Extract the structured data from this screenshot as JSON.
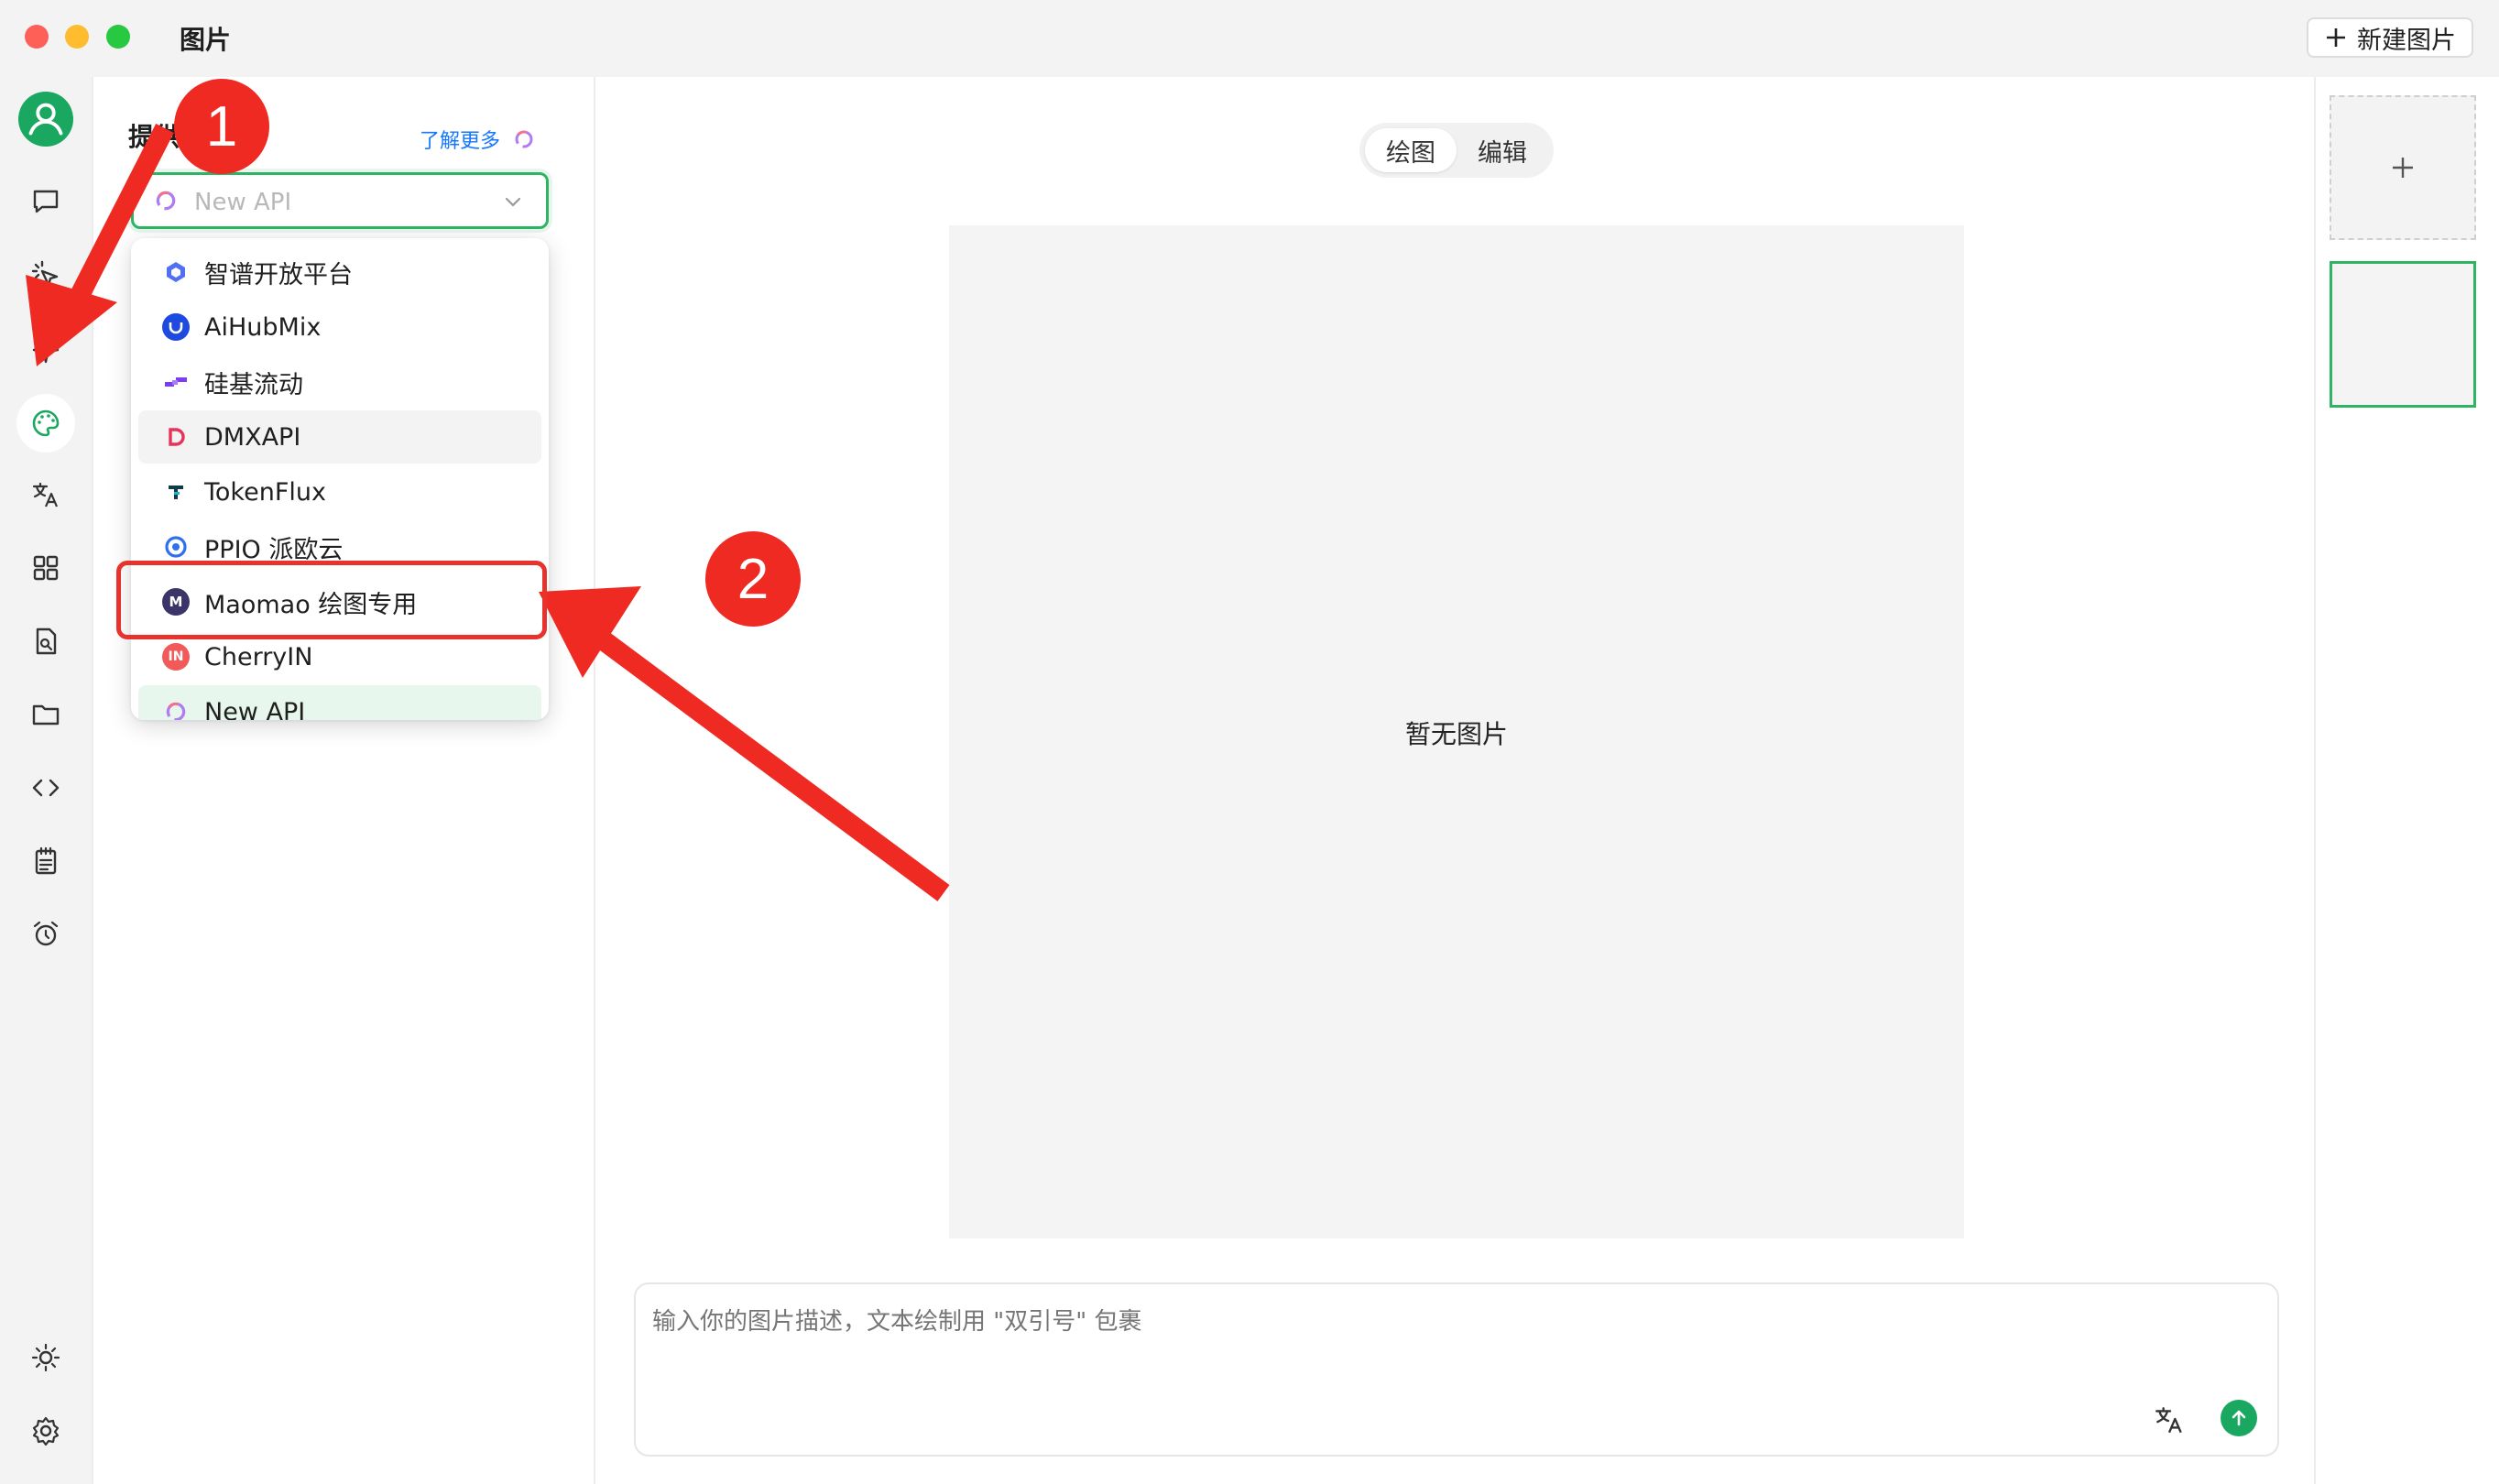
{
  "window": {
    "title": "图片",
    "new_image_label": "新建图片"
  },
  "settings": {
    "provider_label": "提供商",
    "learn_more": "了解更多",
    "selected_provider": "New API"
  },
  "dropdown": {
    "items": [
      {
        "label": "智谱开放平台",
        "logo": "zhipu-icon"
      },
      {
        "label": "AiHubMix",
        "logo": "aihubmix-icon"
      },
      {
        "label": "硅基流动",
        "logo": "siliconflow-icon"
      },
      {
        "label": "DMXAPI",
        "logo": "dmxapi-icon"
      },
      {
        "label": "TokenFlux",
        "logo": "tokenflux-icon"
      },
      {
        "label": "PPIO 派欧云",
        "logo": "ppio-icon"
      },
      {
        "label": "Maomao 绘图专用",
        "logo": "maomao-icon",
        "logo_text": "M"
      },
      {
        "label": "CherryIN",
        "logo": "cherryin-icon",
        "logo_text": "IN"
      },
      {
        "label": "New API",
        "logo": "newapi-icon"
      }
    ]
  },
  "main": {
    "tabs": [
      {
        "label": "绘图"
      },
      {
        "label": "编辑"
      }
    ],
    "empty_text": "暂无图片",
    "prompt_placeholder": "输入你的图片描述，文本绘制用 \"双引号\" 包裹"
  },
  "annotations": {
    "badge_1": "1",
    "badge_2": "2"
  },
  "colors": {
    "accent": "#30b464",
    "annotation_red": "#ee2a22",
    "link": "#1677ff"
  }
}
